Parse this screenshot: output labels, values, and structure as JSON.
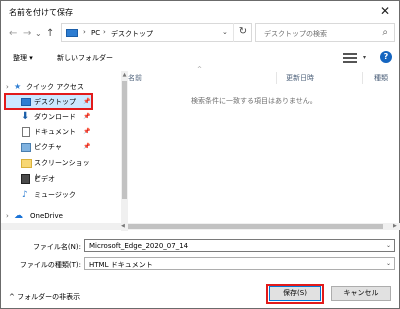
{
  "window": {
    "title": "名前を付けて保存",
    "close": "✕"
  },
  "nav_buttons": {
    "back": "←",
    "forward": "→",
    "dropdown": "⌄",
    "up": "↑"
  },
  "address": {
    "sep1": "›",
    "pc": "PC",
    "sep2": "›",
    "folder": "デスクトップ",
    "dropdown": "⌄",
    "refresh": "↻"
  },
  "search": {
    "placeholder": "デスクトップの検索",
    "icon": "⌕"
  },
  "toolbar": {
    "organize": "整理 ▾",
    "new_folder": "新しいフォルダー",
    "view_dd": "▾",
    "help": "?"
  },
  "sidebar": {
    "items": [
      {
        "label": "クイック アクセス",
        "icon": "star-icon",
        "expander": "›"
      },
      {
        "label": "デスクトップ",
        "icon": "desktop-icon",
        "selected": true
      },
      {
        "label": "ダウンロード",
        "icon": "download-icon"
      },
      {
        "label": "ドキュメント",
        "icon": "document-icon"
      },
      {
        "label": "ピクチャ",
        "icon": "picture-icon"
      },
      {
        "label": "スクリーンショット",
        "icon": "folder-icon"
      },
      {
        "label": "ビデオ",
        "icon": "video-icon"
      },
      {
        "label": "ミュージック",
        "icon": "music-icon"
      },
      {
        "label": "OneDrive",
        "icon": "cloud-icon",
        "expander": "›"
      }
    ],
    "pin": "📌"
  },
  "file_list": {
    "columns": [
      "名前",
      "更新日時",
      "種類"
    ],
    "sort_arrow": "^",
    "empty_message": "検索条件に一致する項目はありません。"
  },
  "form": {
    "filename_label": "ファイル名(N):",
    "filename_value": "Microsoft_Edge_2020_07_14",
    "filetype_label": "ファイルの種類(T):",
    "filetype_value": "HTML ドキュメント",
    "dd": "⌄"
  },
  "footer": {
    "hide_folders": "^  フォルダーの非表示",
    "save": "保存(S)",
    "cancel": "キャンセル"
  },
  "colors": {
    "accent": "#0078d7",
    "highlight_frame": "#e21b1b",
    "selection": "#cce8ff"
  }
}
